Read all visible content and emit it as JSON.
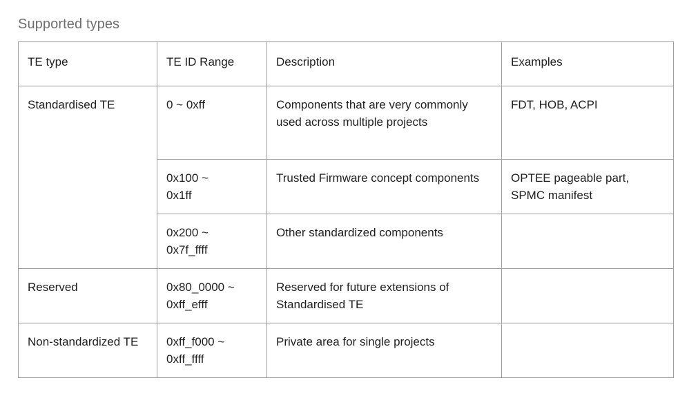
{
  "page": {
    "title": "Supported types",
    "border_color": "#9e9e9e",
    "title_color": "#6e6e6e",
    "text_color": "#1f1f1f"
  },
  "table": {
    "columns": [
      {
        "key": "te_type",
        "label": "TE type"
      },
      {
        "key": "te_id_range",
        "label": "TE ID Range"
      },
      {
        "key": "description",
        "label": "Description"
      },
      {
        "key": "examples",
        "label": "Examples"
      }
    ],
    "rows": [
      {
        "te_type": "Standardised TE",
        "te_type_rowspan": 3,
        "te_id_range": "0 ~ 0xff",
        "description": "Components that are very commonly used across multiple projects",
        "examples": "FDT, HOB, ACPI"
      },
      {
        "te_id_range": "0x100 ~\n0x1ff",
        "description": "Trusted Firmware concept components",
        "examples": "OPTEE pageable part, SPMC manifest"
      },
      {
        "te_id_range": "0x200 ~\n0x7f_ffff",
        "description": "Other standardized components",
        "examples": ""
      },
      {
        "te_type": "Reserved",
        "te_type_rowspan": 1,
        "te_id_range": "0x80_0000 ~\n0xff_efff",
        "description": "Reserved for future extensions of Standardised TE",
        "examples": ""
      },
      {
        "te_type": "Non-standardized TE",
        "te_type_rowspan": 1,
        "te_id_range": "0xff_f000 ~\n0xff_ffff",
        "description": "Private area for single projects",
        "examples": ""
      }
    ]
  }
}
